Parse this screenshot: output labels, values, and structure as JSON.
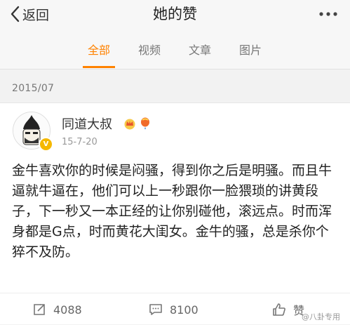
{
  "header": {
    "back_label": "返回",
    "title": "她的赞"
  },
  "tabs": [
    {
      "label": "全部",
      "active": true
    },
    {
      "label": "视频",
      "active": false
    },
    {
      "label": "文章",
      "active": false
    },
    {
      "label": "图片",
      "active": false
    }
  ],
  "feed": {
    "group_date": "2015/07",
    "post": {
      "author": "同道大叔",
      "date": "15-7-20",
      "verified_badge_icon": "verified-v-icon",
      "member_badge_icons": [
        "crown-badge-icon",
        "balloon-badge-icon"
      ],
      "text": "金牛喜欢你的时候是闷骚，得到你之后是明骚。而且牛逼就牛逼在，他们可以上一秒跟你一脸猥琐的讲黄段子，下一秒又一本正经的让你别碰他，滚远点。时而浑身都是G点，时而黄花大闺女。金牛的骚，总是杀你个猝不及防。",
      "actions": {
        "repost_count": "4088",
        "comment_count": "8100",
        "like_label": "赞"
      }
    }
  },
  "watermark": "@八卦专用",
  "colors": {
    "accent": "#ff8200",
    "background": "#f2f2f2"
  }
}
